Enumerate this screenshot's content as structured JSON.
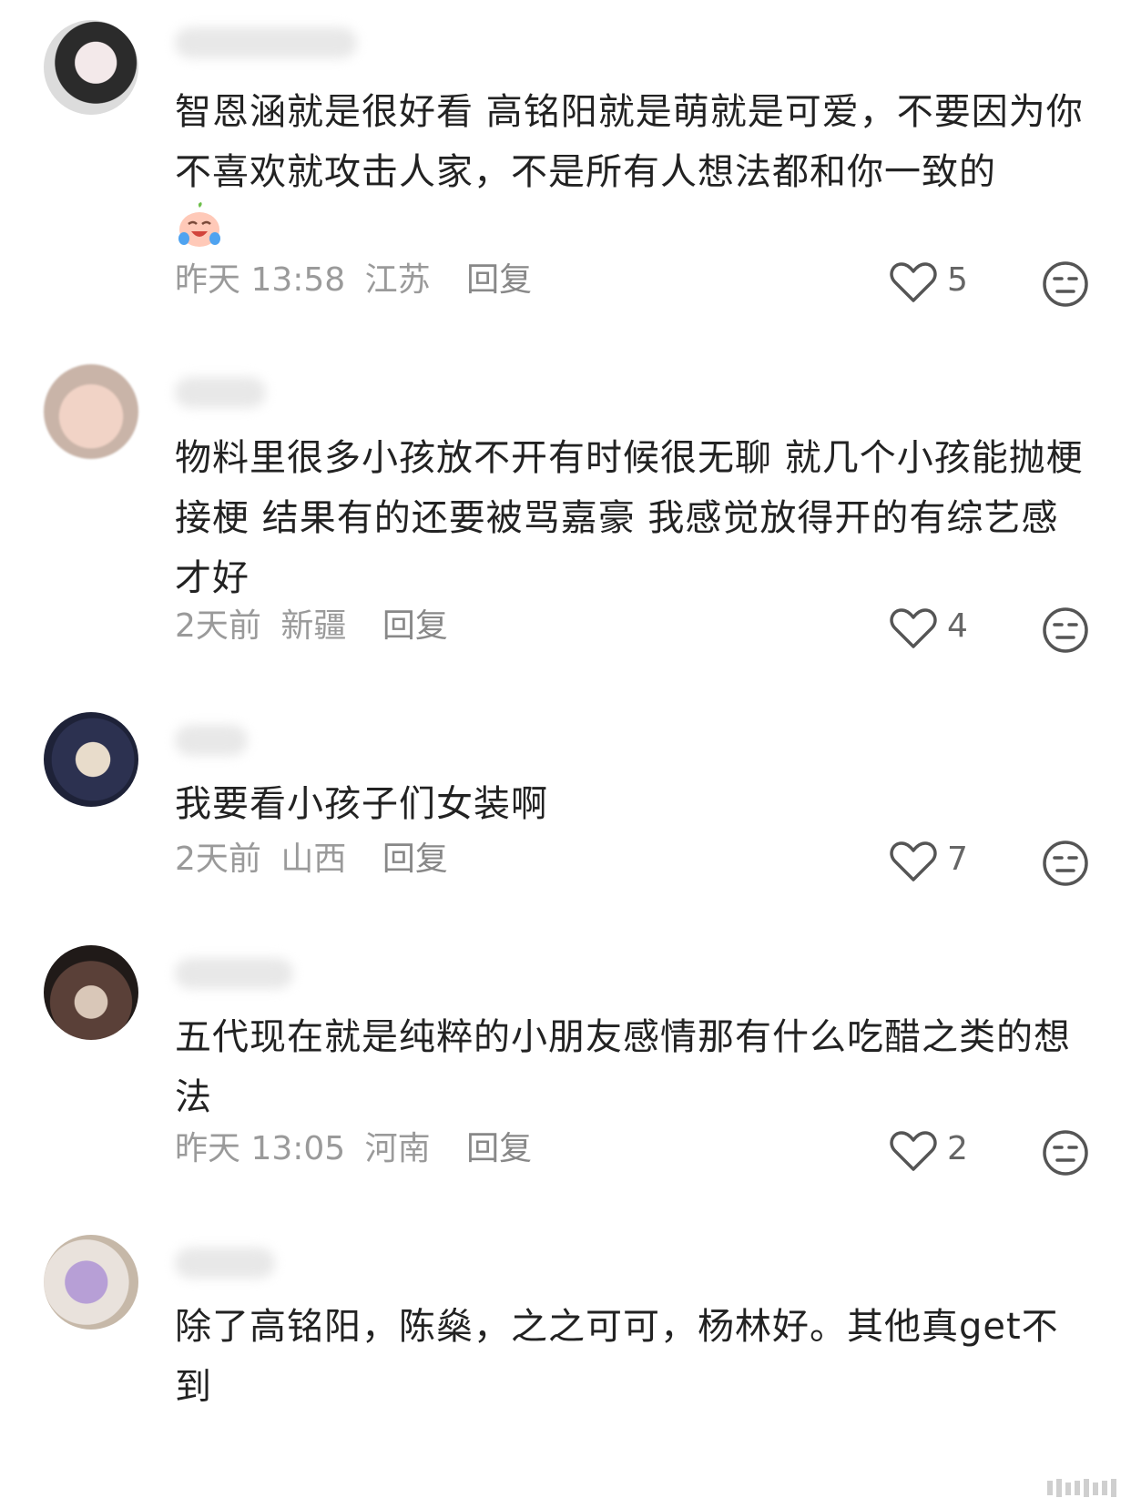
{
  "comments": [
    {
      "text": "智恩涵就是很好看 高铭阳就是萌就是可爱，不要因为你不喜欢就攻击人家，不是所有人想法都和你一致的",
      "time": "昨天 13:58",
      "location": "江苏",
      "reply_label": "回复",
      "likes": "5",
      "has_emoji": true,
      "emoji_icon": "crying-laughing-face-icon"
    },
    {
      "text": "物料里很多小孩放不开有时候很无聊 就几个小孩能抛梗接梗 结果有的还要被骂嘉豪 我感觉放得开的有综艺感才好",
      "time": "2天前",
      "location": "新疆",
      "reply_label": "回复",
      "likes": "4"
    },
    {
      "text": "我要看小孩子们女装啊",
      "time": "2天前",
      "location": "山西",
      "reply_label": "回复",
      "likes": "7"
    },
    {
      "text": "五代现在就是纯粹的小朋友感情那有什么吃醋之类的想法",
      "time": "昨天 13:05",
      "location": "河南",
      "reply_label": "回复",
      "likes": "2"
    },
    {
      "text": "除了高铭阳，陈燊，之之可可，杨林好。其他真get不到",
      "time": "",
      "location": "",
      "reply_label": "",
      "likes": ""
    }
  ],
  "icons": {
    "like": "heart-outline-icon",
    "dislike": "neutral-face-icon"
  },
  "colors": {
    "text": "#222222",
    "meta": "#9a9a9a",
    "icon": "#555555"
  }
}
